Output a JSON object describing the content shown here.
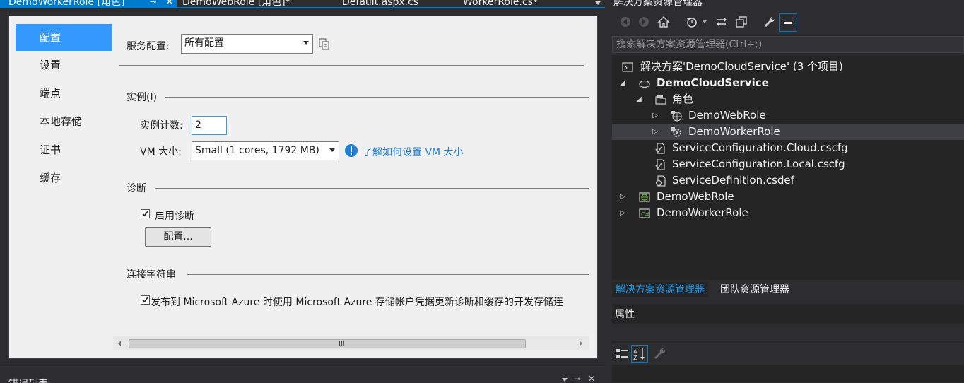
{
  "tabs": [
    {
      "label": "DemoWorkerRole [角色]",
      "active": true
    },
    {
      "label": "DemoWebRole [角色]*"
    },
    {
      "label": "Default.aspx.cs"
    },
    {
      "label": "WorkerRole.cs*"
    }
  ],
  "nav": [
    "配置",
    "设置",
    "端点",
    "本地存储",
    "证书",
    "缓存"
  ],
  "service_config": {
    "label": "服务配置:",
    "value": "所有配置"
  },
  "instances": {
    "section": "实例(I)",
    "count_label": "实例计数:",
    "count_value": "2",
    "vm_label": "VM 大小:",
    "vm_value": "Small (1 cores, 1792 MB)",
    "vm_link": "了解如何设置 VM 大小"
  },
  "diagnostics": {
    "section": "诊断",
    "enable_label": "启用诊断",
    "config_button": "配置..."
  },
  "connection": {
    "section": "连接字符串",
    "checkbox_label": "发布到 Microsoft Azure 时使用 Microsoft Azure 存储帐户凭据更新诊断和缓存的开发存储连"
  },
  "scroll_grip": "III",
  "bottom_panel": {
    "title": "错误列表"
  },
  "solution_explorer": {
    "title": "解决方案资源管理器",
    "search_placeholder": "搜索解决方案资源管理器(Ctrl+;)",
    "tree": [
      {
        "label": "解决方案'DemoCloudService' (3 个项目)",
        "icon": "solution-icon",
        "level": 0,
        "expander": ""
      },
      {
        "label": "DemoCloudService",
        "icon": "cloud-icon",
        "level": 0,
        "expander": "expanded",
        "bold": true
      },
      {
        "label": "角色",
        "icon": "folder-icon",
        "level": 1,
        "expander": "expanded"
      },
      {
        "label": "DemoWebRole",
        "icon": "web-role-icon",
        "level": 2,
        "expander": "collapsed"
      },
      {
        "label": "DemoWorkerRole",
        "icon": "worker-role-icon",
        "level": 2,
        "expander": "collapsed",
        "selected": true
      },
      {
        "label": "ServiceConfiguration.Cloud.cscfg",
        "icon": "config-file-icon",
        "level": 1,
        "expander": ""
      },
      {
        "label": "ServiceConfiguration.Local.cscfg",
        "icon": "config-file-icon",
        "level": 1,
        "expander": ""
      },
      {
        "label": "ServiceDefinition.csdef",
        "icon": "definition-file-icon",
        "level": 1,
        "expander": ""
      },
      {
        "label": "DemoWebRole",
        "icon": "web-project-icon",
        "level": 0,
        "expander": "collapsed"
      },
      {
        "label": "DemoWorkerRole",
        "icon": "csharp-project-icon",
        "level": 0,
        "expander": "collapsed"
      }
    ],
    "bottom_tabs": [
      {
        "label": "解决方案资源管理器",
        "active": true
      },
      {
        "label": "团队资源管理器"
      }
    ]
  },
  "properties": {
    "title": "属性"
  },
  "colors": {
    "accent": "#007acc",
    "selected_nav": "#3399ff",
    "link": "#1e7fd6",
    "dark_bg": "#2d2d30"
  }
}
